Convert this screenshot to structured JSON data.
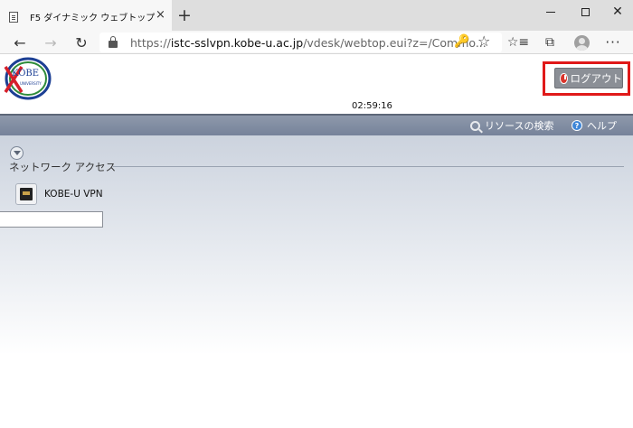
{
  "browser": {
    "tab_title": "F5 ダイナミック ウェブトップ",
    "tab_close_glyph": "×",
    "new_tab_glyph": "+",
    "url_prefix": "https://",
    "url_host": "istc-sslvpn.kobe-u.ac.jp",
    "url_path": "/vdesk/webtop.eui?z=/Commo...",
    "icons": {
      "back": "←",
      "forward": "→",
      "refresh": "↻",
      "key": "🔑",
      "star": "☆",
      "favorites": "☆≡",
      "collections": "⧉",
      "more": "···"
    },
    "window_close": "✕"
  },
  "header": {
    "logo_text": "KOBE",
    "logo_subtext": "UNIVERSITY",
    "logout_label": "ログアウト",
    "session_time": "02:59:16",
    "highlight_color": "#e01919"
  },
  "toolbar": {
    "search_label": "リソースの検索",
    "help_label": "ヘルプ"
  },
  "section": {
    "title": "ネットワーク アクセス",
    "resources": [
      {
        "label": "KOBE-U VPN",
        "icon": "network-port-icon"
      }
    ],
    "input_value": ""
  }
}
